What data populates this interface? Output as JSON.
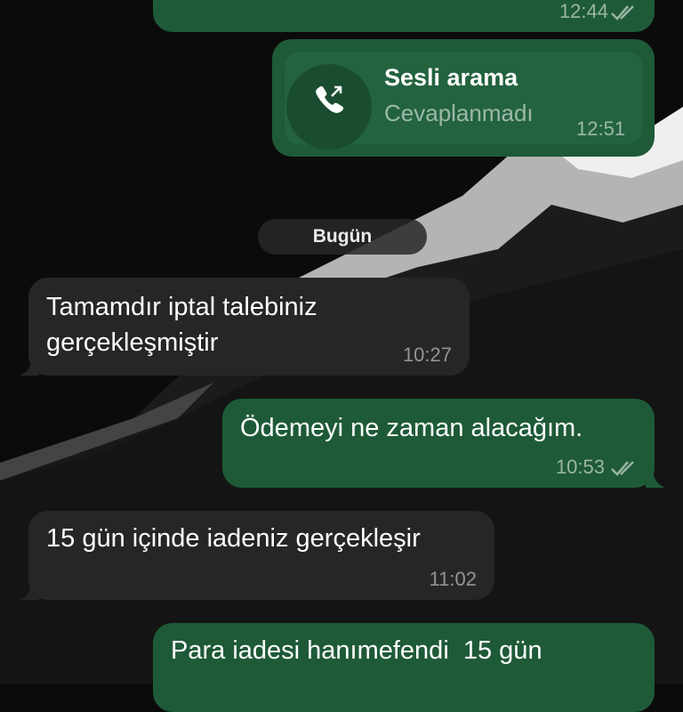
{
  "chat": {
    "msg0": {
      "time": "12:44",
      "status": "read"
    },
    "call": {
      "title": "Sesli arama",
      "status": "Cevaplanmadı",
      "time": "12:51",
      "icon": "outgoing-call-icon"
    },
    "date_separator": "Bugün",
    "msg1": {
      "line1": "Tamamdır iptal talebiniz",
      "line2": "gerçekleşmiştir",
      "time": "10:27"
    },
    "msg2": {
      "text": "Ödemeyi ne zaman alacağım.",
      "time": "10:53",
      "status": "read"
    },
    "msg3": {
      "text": "15 gün içinde iadeniz gerçekleşir",
      "time": "11:02"
    },
    "msg4": {
      "line1": "Para iadesi hanımefendi  15 gün"
    }
  },
  "colors": {
    "incoming_bubble": "#262626",
    "outgoing_bubble": "#1e5a37",
    "background": "#0b0b0b"
  }
}
